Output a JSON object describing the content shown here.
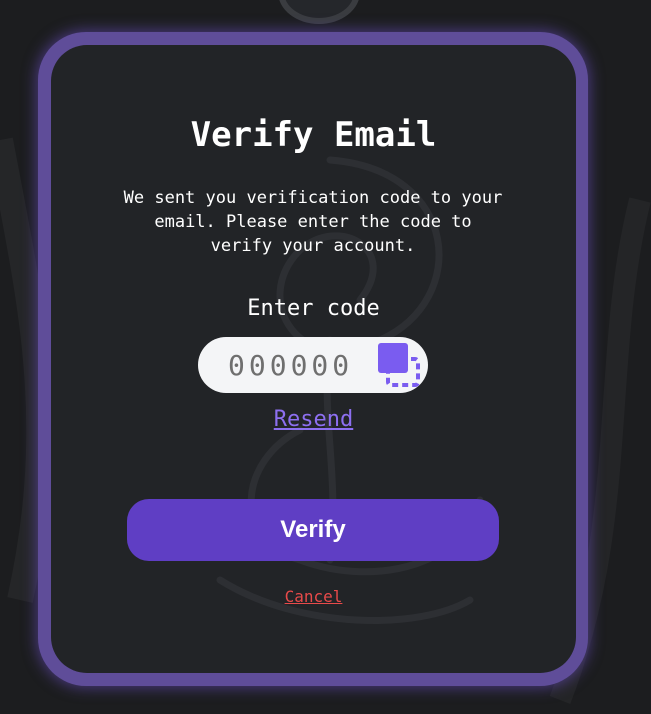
{
  "dialog": {
    "title": "Verify Email",
    "description": "We sent you verification code to your email. Please enter the code to verify your account.",
    "code_label": "Enter code",
    "code_placeholder": "000000",
    "code_value": "",
    "resend_label": "Resend",
    "verify_label": "Verify",
    "cancel_label": "Cancel"
  },
  "icons": {
    "paste": "paste-icon"
  },
  "colors": {
    "accent": "#5f3ec4",
    "frame": "#5f4d99",
    "link": "#8d6ff0",
    "cancel": "#e84a4a",
    "card": "#222427",
    "background": "#1c1d1f"
  }
}
